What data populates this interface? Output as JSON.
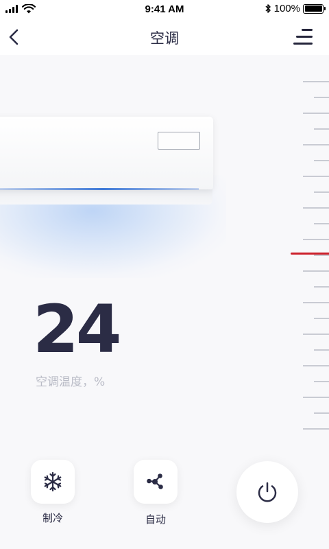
{
  "status_bar": {
    "time": "9:41 AM",
    "battery": "100%"
  },
  "nav": {
    "title": "空调"
  },
  "temperature": {
    "value": "24",
    "label": "空调温度，%"
  },
  "modes": [
    {
      "label": "制冷",
      "icon": "snowflake-icon"
    },
    {
      "label": "自动",
      "icon": "share-nodes-icon"
    }
  ],
  "colors": {
    "primary_text": "#2b2c45",
    "secondary_text": "#b9bbc6",
    "indicator": "#cc1f2a",
    "airflow": "#3f7ad8",
    "background": "#f8f8fa"
  }
}
